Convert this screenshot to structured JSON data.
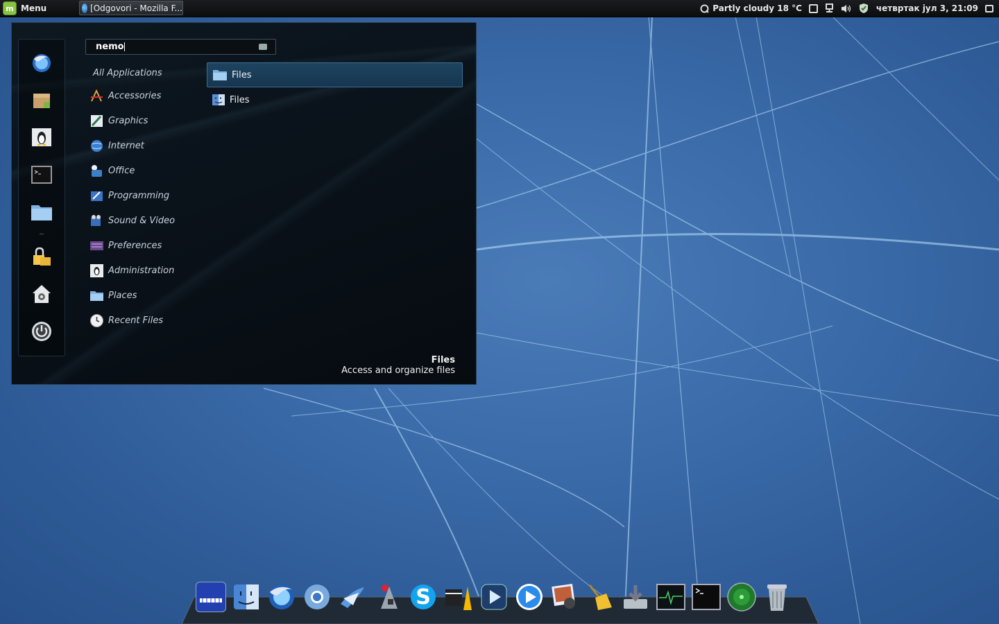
{
  "panel": {
    "menu_label": "Menu",
    "task_label": "[Odgovori - Mozilla F...",
    "weather": "Partly cloudy 18 °C",
    "datetime": "четвртак јул  3, 21:09"
  },
  "menu": {
    "search_value": "nemo",
    "all_applications": "All Applications",
    "categories": [
      {
        "label": "Accessories",
        "icon": "accessories-icon"
      },
      {
        "label": "Graphics",
        "icon": "graphics-icon"
      },
      {
        "label": "Internet",
        "icon": "internet-icon"
      },
      {
        "label": "Office",
        "icon": "office-icon"
      },
      {
        "label": "Programming",
        "icon": "programming-icon"
      },
      {
        "label": "Sound & Video",
        "icon": "sound-video-icon"
      },
      {
        "label": "Preferences",
        "icon": "preferences-icon"
      },
      {
        "label": "Administration",
        "icon": "administration-icon"
      },
      {
        "label": "Places",
        "icon": "places-icon"
      },
      {
        "label": "Recent Files",
        "icon": "recent-files-icon"
      }
    ],
    "results": [
      {
        "label": "Files",
        "icon": "folder-icon",
        "selected": true
      },
      {
        "label": "Files",
        "icon": "finder-icon",
        "selected": false
      }
    ],
    "description_title": "Files",
    "description_text": "Access and organize files"
  },
  "favorites": [
    "firefox-icon",
    "package-icon",
    "tux-icon",
    "terminal-icon",
    "folder-icon",
    "lock-icon",
    "home-settings-icon",
    "power-icon"
  ],
  "dock": [
    "panel-icon",
    "finder-icon",
    "firefox-icon",
    "chromium-icon",
    "mail-icon",
    "sprite-icon",
    "skype-icon",
    "vlc-icon",
    "quicktime-icon",
    "play-icon",
    "photos-icon",
    "broom-icon",
    "install-icon",
    "monitor-icon",
    "terminal-icon",
    "radar-icon",
    "trash-icon"
  ]
}
